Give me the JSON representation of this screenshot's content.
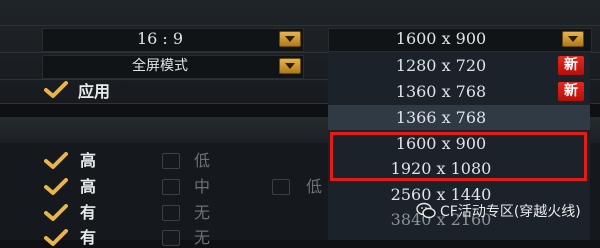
{
  "settings": {
    "aspect_ratio": "16 : 9",
    "display_mode": "全屏模式",
    "current_resolution": "1600 x 900",
    "apply_label": "应用"
  },
  "quality": [
    {
      "checked_label": "高",
      "opt2": "低",
      "opt3": ""
    },
    {
      "checked_label": "高",
      "opt2": "中",
      "opt3": "低"
    },
    {
      "checked_label": "有",
      "opt2": "无",
      "opt3": ""
    },
    {
      "checked_label": "有",
      "opt2": "无",
      "opt3": ""
    }
  ],
  "resolution_options": [
    {
      "label": "1280 x 720",
      "badge": "新",
      "highlighted": false
    },
    {
      "label": "1360 x 768",
      "badge": "新",
      "highlighted": false
    },
    {
      "label": "1366 x 768",
      "badge": "",
      "highlighted": true
    },
    {
      "label": "1600 x 900",
      "badge": "",
      "highlighted": false
    },
    {
      "label": "1920 x 1080",
      "badge": "",
      "highlighted": false
    },
    {
      "label": "2560 x 1440",
      "badge": "",
      "highlighted": false
    },
    {
      "label": "3840 x 2160",
      "badge": "",
      "highlighted": false
    }
  ],
  "watermark": "CF活动专区(穿越火线)",
  "colors": {
    "accent_gold": "#e9b54a",
    "badge_red": "#e42a1e",
    "highlight_border": "#e01e17"
  },
  "icons": {
    "check": "check-icon",
    "dropdown": "chevron-down-icon",
    "wechat": "wechat-icon"
  }
}
